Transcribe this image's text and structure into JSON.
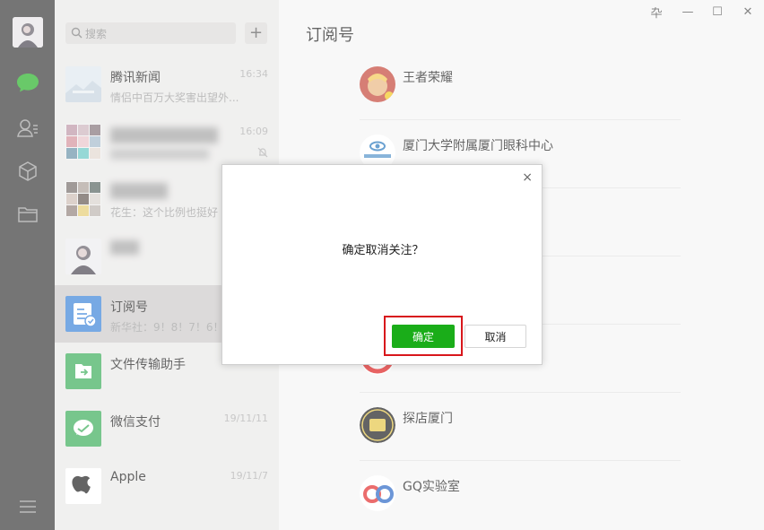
{
  "search": {
    "placeholder": "搜索"
  },
  "chats": [
    {
      "name": "腾讯新闻",
      "preview": "情侣中百万大奖害出望外...",
      "time": "16:34"
    },
    {
      "name": "",
      "preview": "",
      "time": "16:09"
    },
    {
      "name": "",
      "preview": "花生：这个比例也挺好",
      "time": ""
    },
    {
      "name": "",
      "preview": "",
      "time": ""
    },
    {
      "name": "订阅号",
      "preview": "新华社：9！8！7！6！",
      "time": ""
    },
    {
      "name": "文件传输助手",
      "preview": "",
      "time": ""
    },
    {
      "name": "微信支付",
      "preview": "",
      "time": "19/11/11"
    },
    {
      "name": "Apple",
      "preview": "",
      "time": "19/11/7"
    }
  ],
  "main": {
    "title": "订阅号",
    "accounts": [
      {
        "name": "王者荣耀"
      },
      {
        "name": "厦门大学附属厦门眼科中心"
      },
      {
        "name": ""
      },
      {
        "name": ""
      },
      {
        "name": ""
      },
      {
        "name": "探店厦门"
      },
      {
        "name": "GQ实验室"
      }
    ]
  },
  "window": {
    "pin": "卆",
    "minimize": "—",
    "maximize": "☐",
    "close": "✕"
  },
  "dialog": {
    "close": "×",
    "message": "确定取消关注？",
    "ok_label": "确定",
    "cancel_label": "取消"
  },
  "colors": {
    "accent": "#1aad19",
    "highlight": "#d8161b",
    "rail": "#2b2b2b"
  }
}
